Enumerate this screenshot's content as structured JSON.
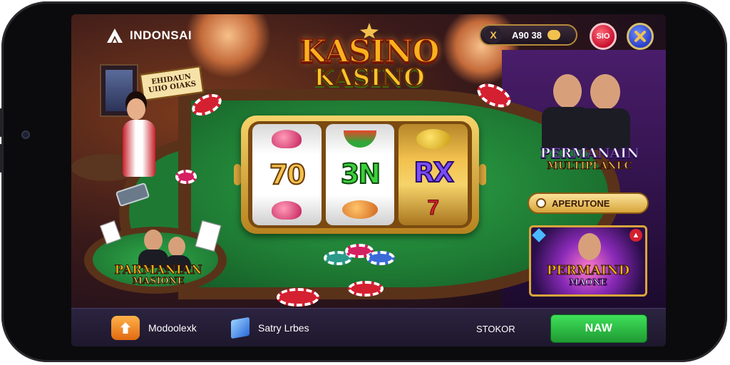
{
  "app": {
    "brand_name": "INDONSAI"
  },
  "header": {
    "coins_icon": "X",
    "coins_value": "A90 38",
    "red_button_label": "SIO",
    "blue_button_icon": "x-icon"
  },
  "title": {
    "line1": "KASINO",
    "line2": "KASINO"
  },
  "slot": {
    "reels": [
      {
        "top": "heart",
        "middle": "70",
        "bottom": "heart"
      },
      {
        "top": "watermelon",
        "middle": "3N",
        "bottom": "peach"
      },
      {
        "top": "lemon",
        "middle": "RX",
        "bottom": "seven"
      }
    ],
    "seven_glyph": "7"
  },
  "left_panel": {
    "sign_line1": "EHIDAUN",
    "sign_line2": "UIIO OIAKS",
    "table_line1": "PARMANIAN",
    "table_line2": "MASIONE"
  },
  "right_panel": {
    "label_line1": "PERMANAIN",
    "label_line2": "MULTIPLANEC",
    "aper_button": "APERUTONE",
    "promo_line1": "PERMAIND",
    "promo_line2": "MAONE"
  },
  "bottom_bar": {
    "tab1_label": "Modoolexk",
    "tab2_label": "Satry Lrbes",
    "stok_label": "STOKOR",
    "new_button": "NAW"
  },
  "colors": {
    "accent_gold": "#f2c14e",
    "felt_green": "#1e7a33",
    "new_button_green": "#3fe05a",
    "bottom_bar": "#1d172c"
  }
}
